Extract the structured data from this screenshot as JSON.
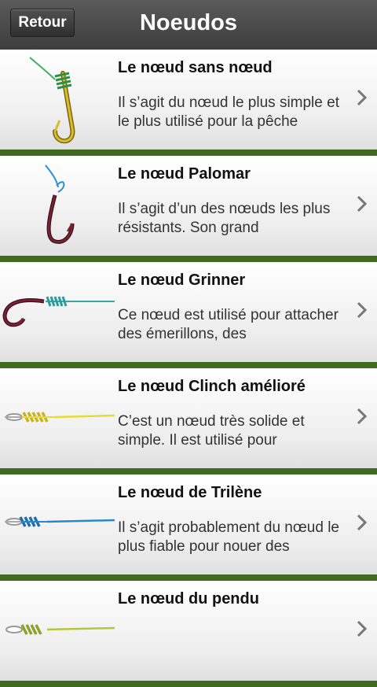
{
  "header": {
    "back_label": "Retour",
    "title": "Noeudos"
  },
  "knots": [
    {
      "title": "Le nœud sans nœud",
      "desc": "Il s’agit du nœud le plus simple et le plus utilisé pour la pêche",
      "icon": "hook-snell-knot-icon",
      "color": "#c9b21e"
    },
    {
      "title": "Le nœud Palomar",
      "desc": "Il s’agit d’un des nœuds les plus résistants. Son grand",
      "icon": "hook-palomar-knot-icon",
      "color": "#5c1d2c"
    },
    {
      "title": "Le nœud Grinner",
      "desc": "Ce nœud est utilisé pour attacher des émerillons, des",
      "icon": "hook-grinner-knot-icon",
      "color": "#3aa6a6"
    },
    {
      "title": "Le nœud Clinch amélioré",
      "desc": "C’est un nœud très solide et simple. Il est utilisé pour",
      "icon": "clinch-knot-icon",
      "color": "#e5dc3b"
    },
    {
      "title": "Le nœud de Trilène",
      "desc": "Il s’agit probablement du nœud le plus fiable pour nouer des",
      "icon": "trilene-knot-icon",
      "color": "#2a88c8"
    },
    {
      "title": "Le nœud du pendu",
      "desc": "",
      "icon": "hangman-knot-icon",
      "color": "#b7c63a"
    }
  ]
}
